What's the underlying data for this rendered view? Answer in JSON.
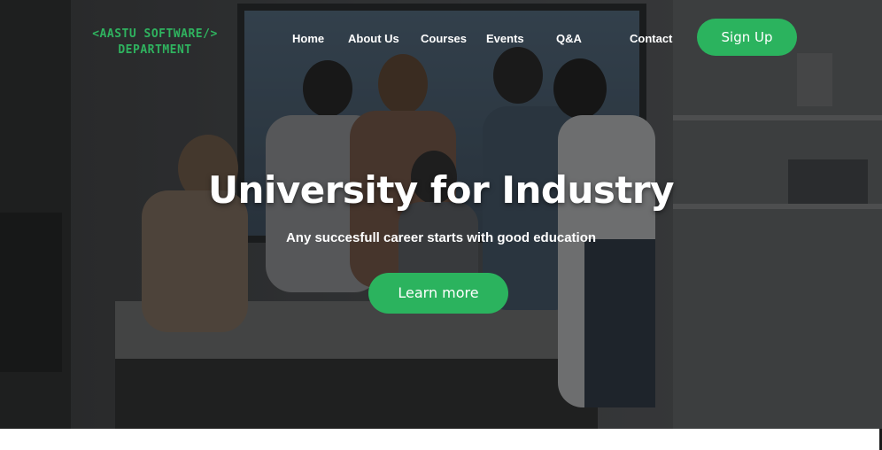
{
  "brand": {
    "line1": "<AASTU SOFTWARE/>",
    "line2": "DEPARTMENT",
    "color": "#2fb35f"
  },
  "nav": {
    "items": [
      {
        "label": "Home"
      },
      {
        "label": "About Us"
      },
      {
        "label": "Courses"
      },
      {
        "label": "Events"
      },
      {
        "label": "Q&A"
      },
      {
        "label": "Contact"
      }
    ],
    "signup_label": "Sign Up"
  },
  "hero": {
    "title": "University for Industry",
    "subtitle": "Any succesfull career starts with good education",
    "cta_label": "Learn more",
    "background": "photo of students collaborating around a table in a classroom",
    "accent_color": "#2bb35e"
  }
}
